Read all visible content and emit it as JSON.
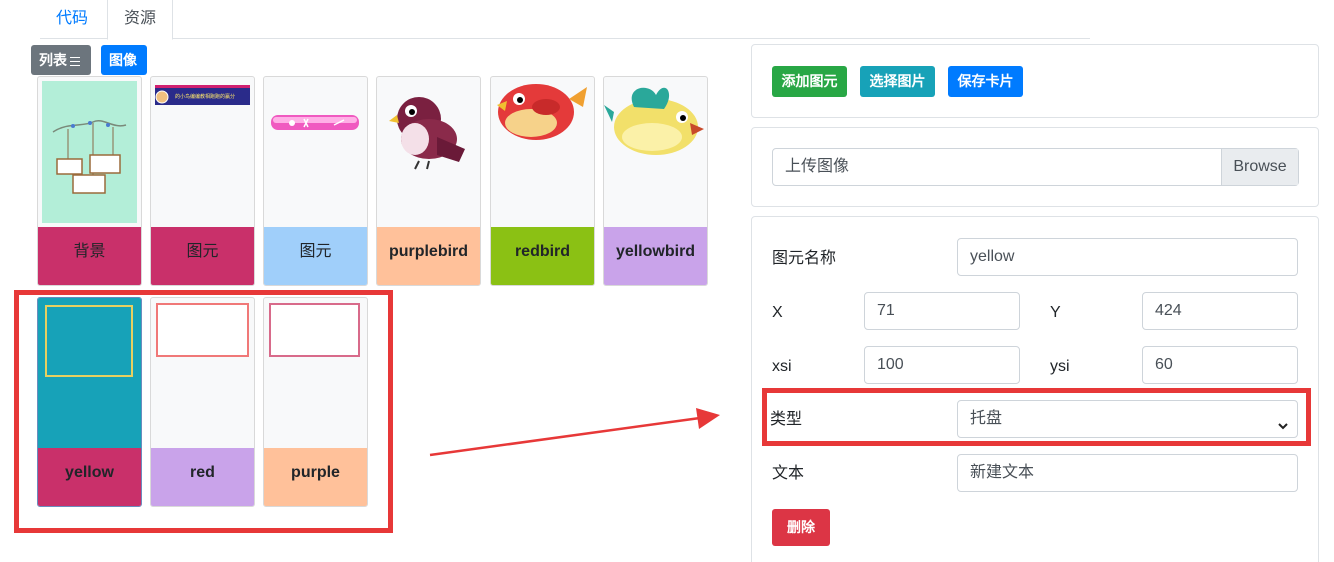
{
  "tabs": {
    "code": "代码",
    "assets": "资源"
  },
  "view": {
    "list_label": "列表",
    "image_label": "图像"
  },
  "cards": [
    {
      "label": "背景",
      "color": "#c9306a"
    },
    {
      "label": "图元",
      "color": "#c9306a"
    },
    {
      "label": "图元",
      "color": "#a0cffa"
    },
    {
      "label": "purplebird",
      "color": "#ffc19a"
    },
    {
      "label": "redbird",
      "color": "#8bc114"
    },
    {
      "label": "yellowbird",
      "color": "#c9a3ea"
    },
    {
      "label": "yellow",
      "color": "#c9306a",
      "thumb_color": "#17a2b8"
    },
    {
      "label": "red",
      "color": "#c9a3ea"
    },
    {
      "label": "purple",
      "color": "#ffc19a"
    }
  ],
  "thumb_text": "的小鸟编编教相跑跑的赢分",
  "actions": {
    "add": "添加图元",
    "choose": "选择图片",
    "save": "保存卡片"
  },
  "upload": {
    "label": "上传图像",
    "browse": "Browse"
  },
  "form": {
    "name_label": "图元名称",
    "name_value": "yellow",
    "x_label": "X",
    "x_value": "71",
    "y_label": "Y",
    "y_value": "424",
    "xsi_label": "xsi",
    "xsi_value": "100",
    "ysi_label": "ysi",
    "ysi_value": "60",
    "type_label": "类型",
    "type_value": "托盘",
    "text_label": "文本",
    "text_value": "新建文本",
    "delete_label": "删除"
  },
  "colors": {
    "primary": "#007bff",
    "success": "#28a745",
    "info": "#17a2b8",
    "danger": "#dc3545",
    "annotation": "#e73838"
  }
}
